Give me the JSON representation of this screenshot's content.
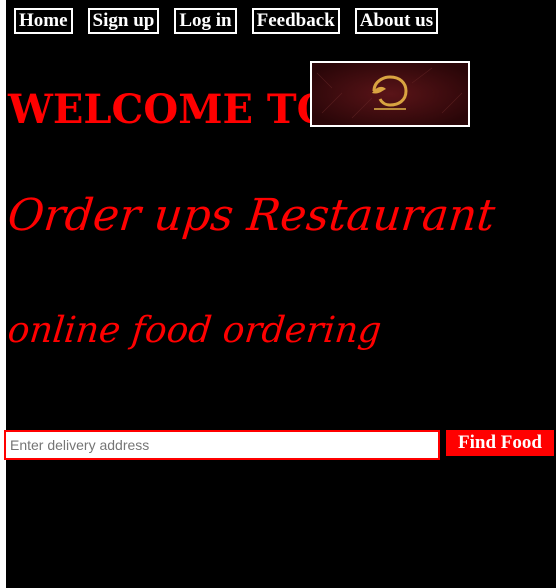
{
  "nav": {
    "items": [
      {
        "label": "Home"
      },
      {
        "label": "Sign up"
      },
      {
        "label": "Log in"
      },
      {
        "label": "Feedback"
      },
      {
        "label": "About us"
      }
    ]
  },
  "hero": {
    "welcome": "WELCOME TO",
    "restaurant_name": "Order ups Restaurant",
    "tagline": "online food ordering"
  },
  "search": {
    "placeholder": "Enter delivery address",
    "value": "",
    "button_label": "Find Food"
  },
  "colors": {
    "background": "#000000",
    "accent": "#ff0000",
    "nav_text": "#ffffff"
  },
  "logo": {
    "icon": "restaurant-logo"
  }
}
